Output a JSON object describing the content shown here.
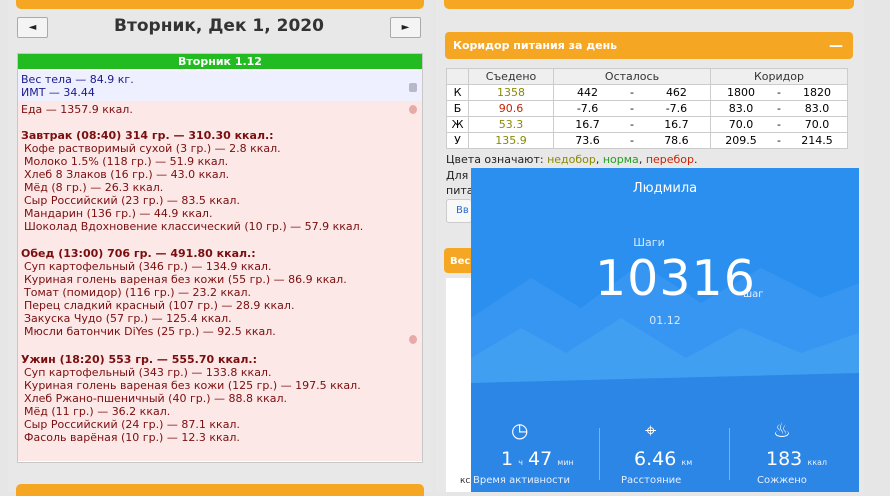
{
  "day": {
    "date_title": "Вторник, Дек 1, 2020",
    "prev_label": "◄",
    "next_label": "►",
    "header": "Вторник 1.12",
    "weight_line": "Вес тела — 84.9 кг.",
    "bmi_line": "ИМТ — 34.44",
    "food_total": "Еда — 1357.9 ккал.",
    "meals": [
      {
        "title": "Завтрак (08:40) 314 гр. — 310.30 ккал.:",
        "items": [
          "Кофе растворимый сухой (3 гр.) — 2.8 ккал.",
          "Молоко 1.5% (118 гр.) — 51.9 ккал.",
          "Хлеб 8 Злаков (16 гр.) — 43.0 ккал.",
          "Мёд (8 гр.) — 26.3 ккал.",
          "Сыр Российский (23 гр.) — 83.5 ккал.",
          "Мандарин (136 гр.) — 44.9 ккал.",
          "Шоколад Вдохновение классический (10 гр.) — 57.9 ккал."
        ]
      },
      {
        "title": "Обед (13:00) 706 гр. — 491.80 ккал.:",
        "items": [
          "Суп картофельный (346 гр.) — 134.9 ккал.",
          "Куриная голень вареная без кожи (55 гр.) — 86.9 ккал.",
          "Томат (помидор) (116 гр.) — 23.2 ккал.",
          "Перец сладкий красный (107 гр.) — 28.9 ккал.",
          "Закуска Чудо (57 гр.) — 125.4 ккал.",
          "Мюсли батончик DiYes (25 гр.) — 92.5 ккал."
        ]
      },
      {
        "title": "Ужин (18:20) 553 гр. — 555.70 ккал.:",
        "items": [
          "Суп картофельный (343 гр.) — 133.8 ккал.",
          "Куриная голень вареная без кожи (125 гр.) — 197.5 ккал.",
          "Хлеб Ржано-пшеничный (40 гр.) — 88.8 ккал.",
          "Мёд (11 гр.) — 36.2 ккал.",
          "Сыр Российский (24 гр.) — 87.1 ккал.",
          "Фасоль варёная (10 гр.) — 12.3 ккал."
        ]
      }
    ]
  },
  "corridor": {
    "title": "Коридор питания за день",
    "minimize": "—",
    "col_eaten": "Съедено",
    "col_left": "Осталось",
    "col_corridor": "Коридор",
    "rows": [
      {
        "k": "К",
        "eaten": "1358",
        "eaten_color": "#8a8a00",
        "l1": "442",
        "l2": "462",
        "c1": "1800",
        "c2": "1820"
      },
      {
        "k": "Б",
        "eaten": "90.6",
        "eaten_color": "#cc2200",
        "l1": "-7.6",
        "l2": "-7.6",
        "c1": "83.0",
        "c2": "83.0"
      },
      {
        "k": "Ж",
        "eaten": "53.3",
        "eaten_color": "#8a8a00",
        "l1": "16.7",
        "l2": "16.7",
        "c1": "70.0",
        "c2": "70.0"
      },
      {
        "k": "У",
        "eaten": "135.9",
        "eaten_color": "#8a8a00",
        "l1": "73.6",
        "l2": "78.6",
        "c1": "209.5",
        "c2": "214.5"
      }
    ],
    "dash": "-",
    "legend_prefix": "Цвета означают: ",
    "legend_under": "недобор",
    "legend_norm": "норма",
    "legend_over": "перебор",
    "legend_sep": ", ",
    "legend_end": ".",
    "colors": {
      "under": "#8a8a00",
      "norm": "#22a022",
      "over": "#cc2200"
    },
    "cut_text_1": "Для",
    "cut_text_2": "пита",
    "cut_button": "Вв",
    "cut_orange": "Вес",
    "cut_letters": "кс"
  },
  "phone": {
    "user_name": "Людмила",
    "steps_label": "Шаги",
    "steps_value": "10316",
    "steps_unit": "шаг",
    "date": "01.12",
    "stats": [
      {
        "icon": "clock-icon",
        "glyph": "◷",
        "value": "1",
        "value2": "47",
        "unit1": "ч",
        "unit2": "мин",
        "label": "Время активности"
      },
      {
        "icon": "location-icon",
        "glyph": "⌖",
        "value": "6.46",
        "unit1": "км",
        "label": "Расстояние"
      },
      {
        "icon": "flame-icon",
        "glyph": "♨",
        "value": "183",
        "unit1": "ккал",
        "label": "Сожжено"
      }
    ]
  }
}
